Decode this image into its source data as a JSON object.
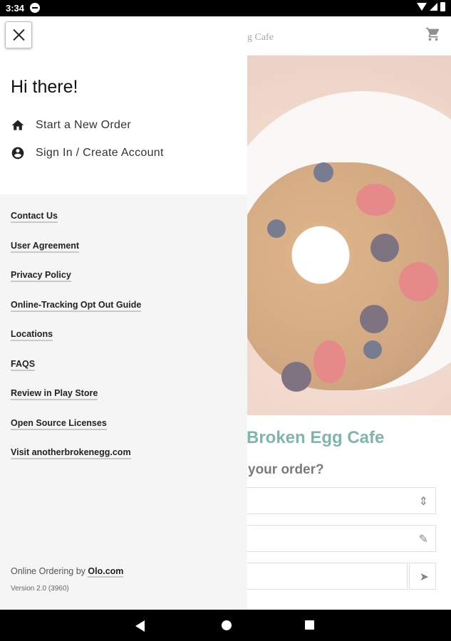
{
  "status_bar": {
    "time": "3:34",
    "icons": [
      "dnd-icon",
      "wifi-icon",
      "cell-signal-icon",
      "battery-icon"
    ]
  },
  "background_app": {
    "brand": "gg Cafe",
    "title": "Broken Egg Cafe",
    "question": "your order?",
    "field_icons": [
      "select-arrows-icon",
      "pencil-icon",
      "location-arrow-icon"
    ],
    "accent_color": "#3a8f82"
  },
  "drawer": {
    "greeting": "Hi there!",
    "menu": [
      {
        "label": "Start a New Order",
        "icon": "home-icon"
      },
      {
        "label": "Sign In / Create Account",
        "icon": "account-circle-icon"
      }
    ],
    "links": [
      "Contact Us",
      "User Agreement",
      "Privacy Policy",
      "Online-Tracking Opt Out Guide",
      "Locations",
      "FAQS",
      "Review in Play Store",
      "Open Source Licenses",
      "Visit anotherbrokenegg.com"
    ],
    "footer": {
      "prefix": "Online Ordering by",
      "link": "Olo.com",
      "version": "Version 2.0 (3960)"
    }
  },
  "nav_bar": {
    "buttons": [
      "back-icon",
      "home-circle-icon",
      "recents-icon"
    ]
  }
}
